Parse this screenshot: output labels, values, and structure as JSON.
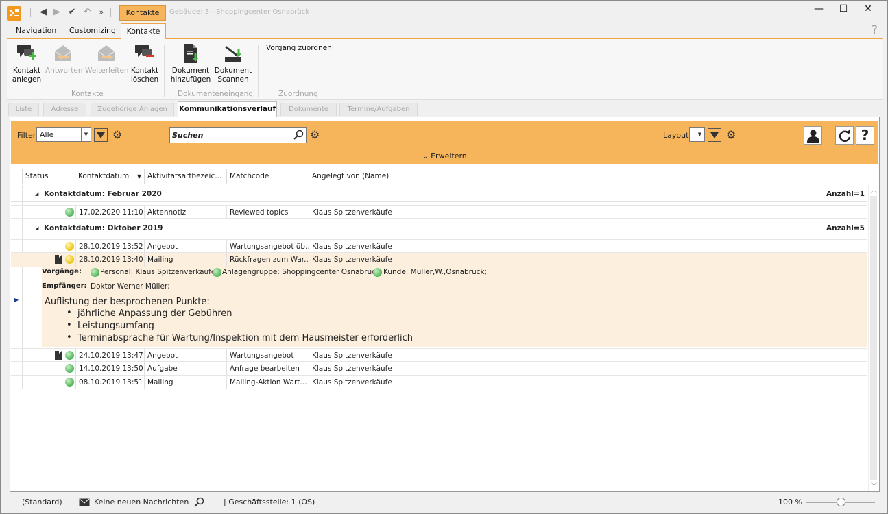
{
  "titlebar": {
    "context_tab": "Kontakte",
    "title": "Gebäude: 3 - Shoppingcenter Osnabrück",
    "minimize": "—",
    "maximize": "☐",
    "close": "✕"
  },
  "ribbon_tabs": [
    "Navigation",
    "Customizing",
    "Kontakte"
  ],
  "help": "?",
  "ribbon": {
    "buttons": [
      {
        "line1": "Kontakt",
        "line2": "anlegen",
        "enabled": true
      },
      {
        "line1": "Antworten",
        "line2": "",
        "enabled": false
      },
      {
        "line1": "Weiterleiten",
        "line2": "",
        "enabled": false
      },
      {
        "line1": "Kontakt",
        "line2": "löschen",
        "enabled": true
      },
      {
        "line1": "Dokument",
        "line2": "hinzufügen",
        "enabled": true
      },
      {
        "line1": "Dokument",
        "line2": "Scannen",
        "enabled": true
      }
    ],
    "vorgang_zuordnen": "Vorgang zuordnen",
    "groups": [
      "Kontakte",
      "Dokumenteneingang",
      "Zuordnung"
    ]
  },
  "doc_tabs": [
    "Liste",
    "Adresse",
    "Zugehörige Anlagen",
    "Kommunikationsverlauf",
    "Dokumente",
    "Termine/Aufgaben"
  ],
  "filterbar": {
    "filter_label": "Filter",
    "filter_value": "Alle",
    "search_placeholder": "Suchen",
    "layout_label": "Layout",
    "expand_label": "Erweitern"
  },
  "grid": {
    "columns": [
      "Status",
      "Kontaktdatum",
      "Aktivitätsartbezeic...",
      "Matchcode",
      "Angelegt von (Name)"
    ],
    "groups": [
      {
        "title": "Kontaktdatum: Februar 2020",
        "count": "Anzahl=1",
        "rows": [
          {
            "status": "green",
            "doc": false,
            "date": "17.02.2020 11:10",
            "type": "Aktennotiz",
            "match": "Reviewed topics",
            "by": "Klaus Spitzenverkäufer"
          }
        ]
      },
      {
        "title": "Kontaktdatum: Oktober 2019",
        "count": "Anzahl=5",
        "rows": [
          {
            "status": "yellow",
            "doc": false,
            "date": "28.10.2019 13:52",
            "type": "Angebot",
            "match": "Wartungsangebot üb...",
            "by": "Klaus Spitzenverkäufer"
          },
          {
            "status": "yellow",
            "doc": true,
            "date": "28.10.2019 13:40",
            "type": "Mailing",
            "match": "Rückfragen zum War...",
            "by": "Klaus Spitzenverkäufer"
          },
          {
            "status": "green",
            "doc": true,
            "date": "24.10.2019 13:47",
            "type": "Angebot",
            "match": "Wartungsangebot",
            "by": "Klaus Spitzenverkäufer"
          },
          {
            "status": "green",
            "doc": false,
            "date": "14.10.2019 13:50",
            "type": "Aufgabe",
            "match": "Anfrage bearbeiten",
            "by": "Klaus Spitzenverkäufer"
          },
          {
            "status": "green",
            "doc": false,
            "date": "08.10.2019 13:51",
            "type": "Mailing",
            "match": "Mailing-Aktion Wart...",
            "by": "Klaus Spitzenverkäufer"
          }
        ]
      }
    ],
    "detail": {
      "vorgaenge_label": "Vorgänge:",
      "vorgaenge": [
        "Personal: Klaus Spitzenverkäufer;",
        "Anlagengruppe: Shoppingcenter Osnabrück;",
        "Kunde: Müller,W.,Osnabrück;"
      ],
      "empfaenger_label": "Empfänger:",
      "empfaenger": "Doktor Werner Müller;",
      "heading": "Auflistung der besprochenen Punkte:",
      "bullets": [
        "jährliche Anpassung der Gebühren",
        "Leistungsumfang",
        "Terminabsprache für Wartung/Inspektion mit dem Hausmeister erforderlich"
      ]
    }
  },
  "statusbar": {
    "layout": "(Standard)",
    "messages": "Keine neuen Nachrichten",
    "branch": "| Geschäftsstelle:  1 (OS)",
    "zoom": "100 %",
    "zoom_level": 0.5
  }
}
